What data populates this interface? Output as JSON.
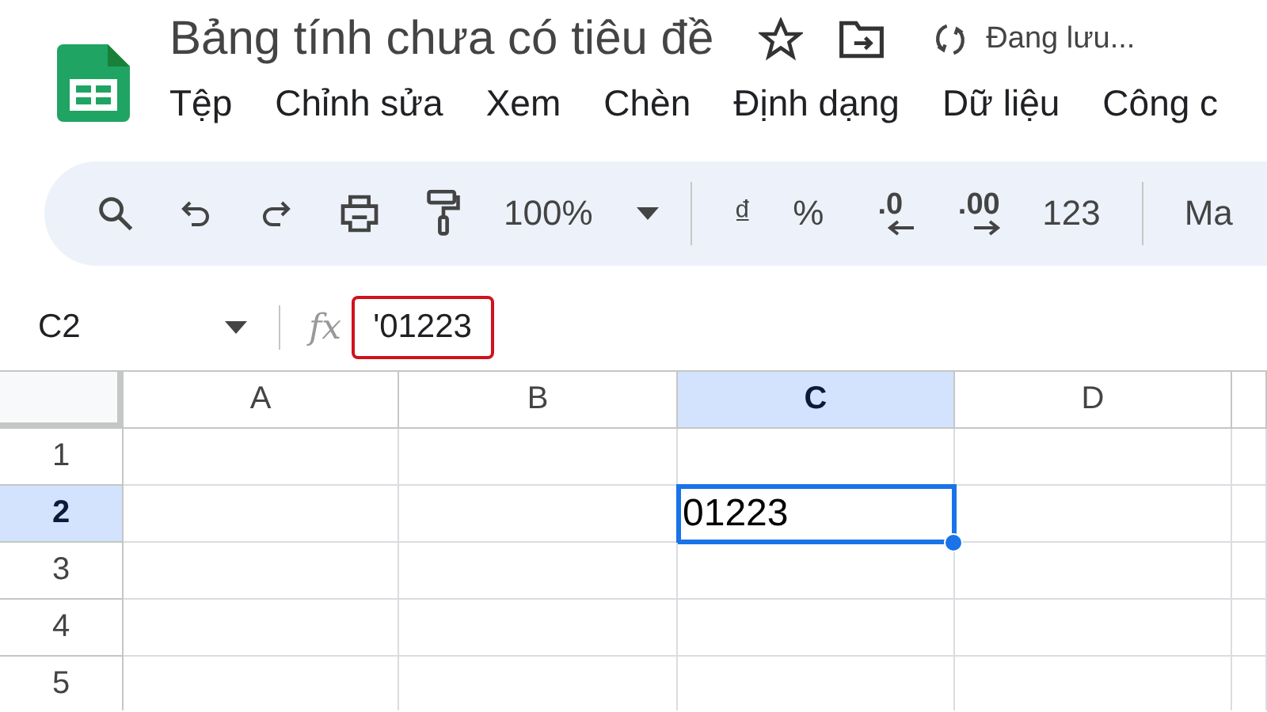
{
  "document": {
    "title": "Bảng tính chưa có tiêu đề",
    "status": "Đang lưu..."
  },
  "menu": [
    "Tệp",
    "Chỉnh sửa",
    "Xem",
    "Chèn",
    "Định dạng",
    "Dữ liệu",
    "Công c"
  ],
  "toolbar": [
    {
      "kind": "search"
    },
    {
      "kind": "undo"
    },
    {
      "kind": "redo"
    },
    {
      "kind": "print"
    },
    {
      "kind": "paint"
    },
    {
      "kind": "zoom",
      "label": "100%"
    },
    {
      "kind": "divider"
    },
    {
      "kind": "text",
      "label": "₫"
    },
    {
      "kind": "text",
      "label": "%"
    },
    {
      "kind": "decrease",
      "label": ".0"
    },
    {
      "kind": "increase",
      "label": ".00"
    },
    {
      "kind": "text",
      "label": "123"
    },
    {
      "kind": "divider"
    },
    {
      "kind": "text",
      "label": "Ma"
    }
  ],
  "formula_bar": {
    "cell_ref": "C2",
    "function_label": "fx",
    "value": "'01223",
    "highlighted": true
  },
  "grid": {
    "columns": [
      {
        "label": "A",
        "selected": false
      },
      {
        "label": "B",
        "selected": false
      },
      {
        "label": "C",
        "selected": true
      },
      {
        "label": "D",
        "selected": false
      }
    ],
    "rows": [
      {
        "label": "1",
        "selected": false,
        "cells": [
          {
            "selected": false
          },
          {
            "selected": false
          },
          {
            "selected": false
          },
          {
            "selected": false
          }
        ]
      },
      {
        "label": "2",
        "selected": true,
        "cells": [
          {
            "selected": false
          },
          {
            "selected": false
          },
          {
            "value": "01223",
            "selected": true
          },
          {
            "selected": false
          }
        ]
      },
      {
        "label": "3",
        "selected": false,
        "cells": [
          {
            "selected": false
          },
          {
            "selected": false
          },
          {
            "selected": false
          },
          {
            "selected": false
          }
        ]
      },
      {
        "label": "4",
        "selected": false,
        "cells": [
          {
            "selected": false
          },
          {
            "selected": false
          },
          {
            "selected": false
          },
          {
            "selected": false
          }
        ]
      },
      {
        "label": "5",
        "selected": false,
        "cells": [
          {
            "selected": false
          },
          {
            "selected": false
          },
          {
            "selected": false
          },
          {
            "selected": false
          }
        ]
      }
    ]
  }
}
